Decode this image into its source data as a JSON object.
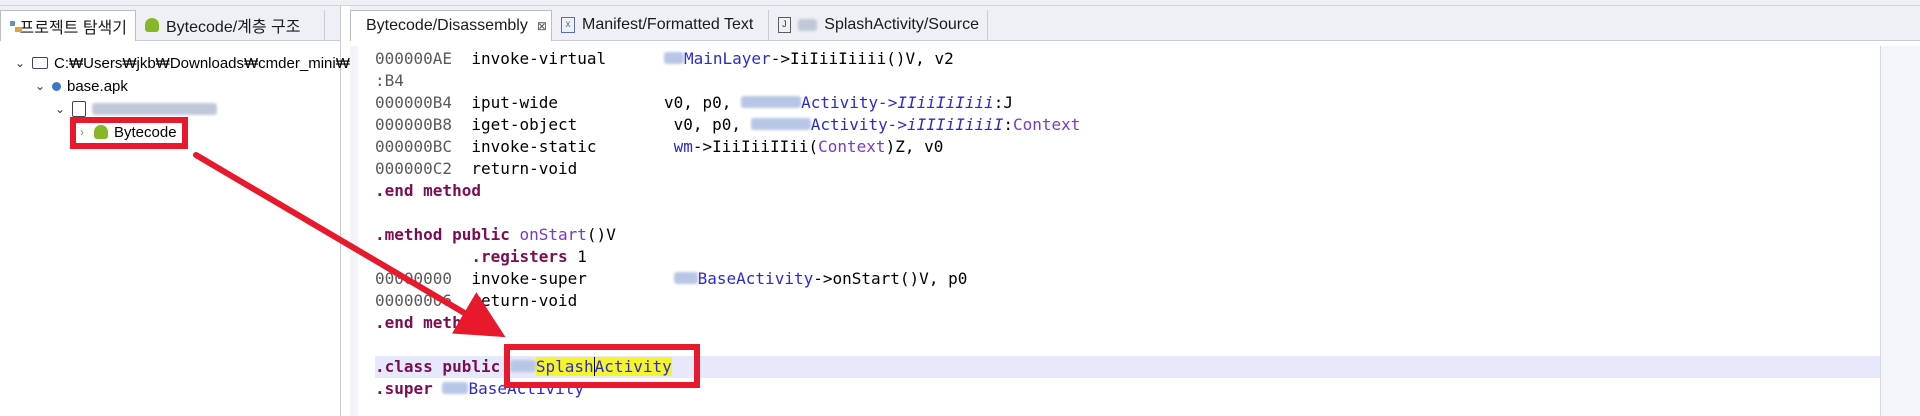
{
  "left_tabs": [
    {
      "label": "프로젝트 탐색기",
      "icon": "explorer-icon",
      "active": true
    },
    {
      "label": "Bytecode/계층 구조",
      "icon": "android-icon",
      "active": false
    }
  ],
  "editor_tabs": [
    {
      "label": "Bytecode/Disassembly",
      "icon": "android-icon",
      "active": true,
      "close": "⊠"
    },
    {
      "label": "Manifest/Formatted Text",
      "icon": "manifest-icon",
      "active": false
    },
    {
      "label": "SplashActivity/Source",
      "icon": "source-icon",
      "active": false
    }
  ],
  "tree": {
    "root_label": "C:₩Users₩jkb₩Downloads₩cmder_mini₩",
    "apk_label": "base.apk",
    "bytecode_label": "Bytecode"
  },
  "code": {
    "l1_addr": "000000AE",
    "l1_op": "invoke-virtual",
    "l1_cls": "MainLayer",
    "l1_method": "->IiIiiIiiii()V, v2",
    "l2": ":B4",
    "l3_addr": "000000B4",
    "l3_op": "iput-wide",
    "l3_args": "v0, p0,",
    "l3_cls": "Activity",
    "l3_field": "->IIiiIiIiii",
    "l3_type": ":J",
    "l4_addr": "000000B8",
    "l4_op": "iget-object",
    "l4_args": "v0, p0,",
    "l4_cls": "Activity",
    "l4_field": "->iIIIiIiiiI",
    "l4_sep": ":",
    "l4_type": "Context",
    "l5_addr": "000000BC",
    "l5_op": "invoke-static",
    "l5_cls": "wm",
    "l5_method": "->IiiIiiIIii(",
    "l5_type": "Context",
    "l5_rest": ")Z, v0",
    "l6_addr": "000000C2",
    "l6_op": "return-void",
    "l7": ".end method",
    "l9_kw": ".method public",
    "l9_name": " onStart",
    "l9_rest": "()V",
    "l10": ".registers",
    "l10_val": " 1",
    "l11_addr": "00000000",
    "l11_op": "invoke-super",
    "l11_cls": "BaseActivity",
    "l11_rest": "->onStart()V, p0",
    "l12_addr": "00000006",
    "l12_op": "return-void",
    "l13": ".end method",
    "l15_kw": ".class public",
    "l15_cls_a": "Splash",
    "l15_cls_b": "Activity",
    "l16_kw": ".super",
    "l16_cls": "BaseActivity"
  },
  "colors": {
    "annotation": "#e8192c",
    "keyword": "#7b0d52",
    "reference": "#2a2ad0",
    "member": "#7a38c8"
  }
}
